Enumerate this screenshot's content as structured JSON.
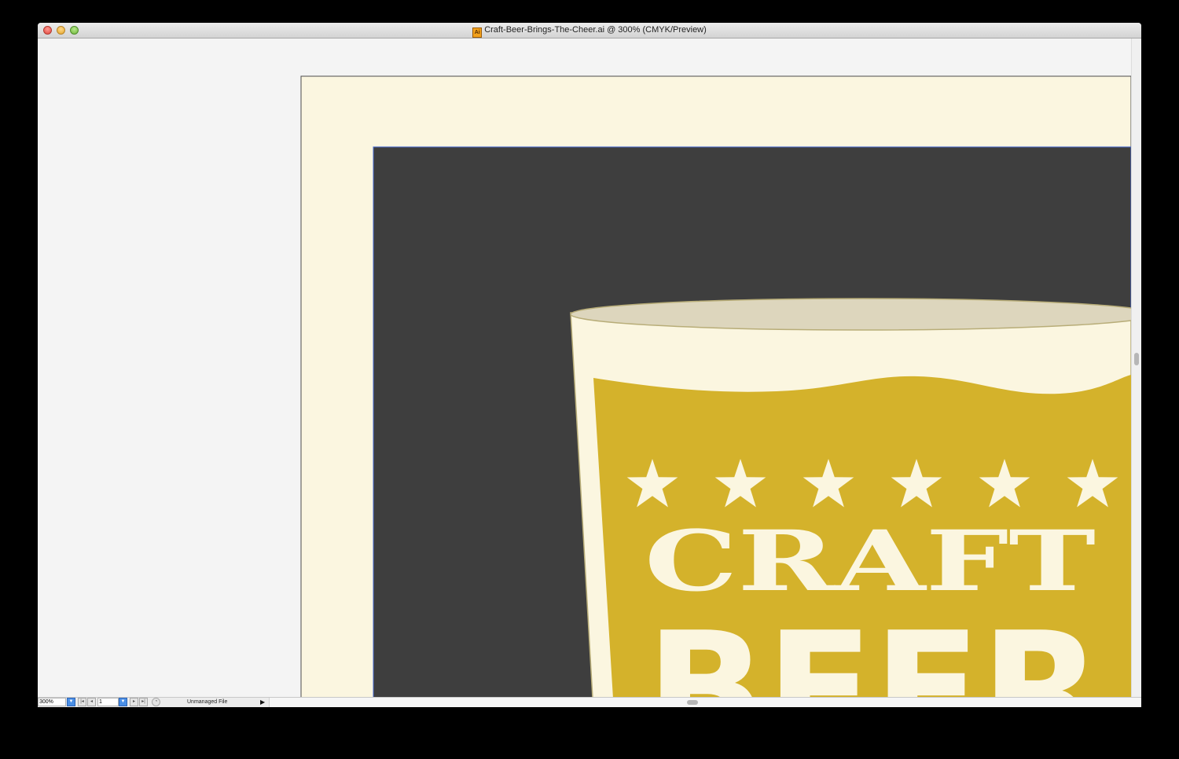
{
  "window": {
    "title": "Craft-Beer-Brings-The-Cheer.ai @ 300% (CMYK/Preview)",
    "doc_icon_label": "Ai"
  },
  "artwork": {
    "headline": "CRAFT",
    "subline": "BEER",
    "star_count": 6,
    "colors": {
      "paper": "#fbf6e0",
      "board": "#3e3e3e",
      "glass": "#fbf6e0",
      "beer": "#d4b22b",
      "foam_top": "#ddd6bd",
      "guide": "#4a6fd8"
    }
  },
  "statusbar": {
    "zoom": "300%",
    "page": "1",
    "file_status": "Unmanaged File",
    "icons": [
      "zoom-dropdown",
      "first-page",
      "previous-page",
      "page-dropdown",
      "next-page",
      "last-page",
      "status-menu"
    ]
  }
}
